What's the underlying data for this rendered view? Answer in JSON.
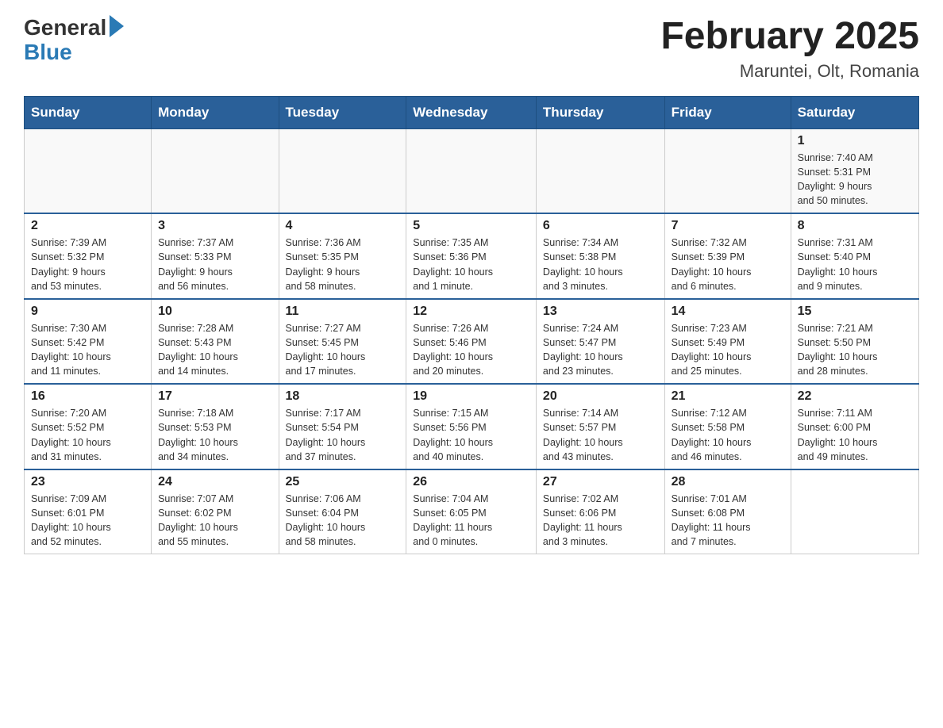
{
  "header": {
    "logo_general": "General",
    "logo_blue": "Blue",
    "month_title": "February 2025",
    "location": "Maruntei, Olt, Romania"
  },
  "days_of_week": [
    "Sunday",
    "Monday",
    "Tuesday",
    "Wednesday",
    "Thursday",
    "Friday",
    "Saturday"
  ],
  "weeks": [
    {
      "days": [
        {
          "num": "",
          "info": ""
        },
        {
          "num": "",
          "info": ""
        },
        {
          "num": "",
          "info": ""
        },
        {
          "num": "",
          "info": ""
        },
        {
          "num": "",
          "info": ""
        },
        {
          "num": "",
          "info": ""
        },
        {
          "num": "1",
          "info": "Sunrise: 7:40 AM\nSunset: 5:31 PM\nDaylight: 9 hours\nand 50 minutes."
        }
      ]
    },
    {
      "days": [
        {
          "num": "2",
          "info": "Sunrise: 7:39 AM\nSunset: 5:32 PM\nDaylight: 9 hours\nand 53 minutes."
        },
        {
          "num": "3",
          "info": "Sunrise: 7:37 AM\nSunset: 5:33 PM\nDaylight: 9 hours\nand 56 minutes."
        },
        {
          "num": "4",
          "info": "Sunrise: 7:36 AM\nSunset: 5:35 PM\nDaylight: 9 hours\nand 58 minutes."
        },
        {
          "num": "5",
          "info": "Sunrise: 7:35 AM\nSunset: 5:36 PM\nDaylight: 10 hours\nand 1 minute."
        },
        {
          "num": "6",
          "info": "Sunrise: 7:34 AM\nSunset: 5:38 PM\nDaylight: 10 hours\nand 3 minutes."
        },
        {
          "num": "7",
          "info": "Sunrise: 7:32 AM\nSunset: 5:39 PM\nDaylight: 10 hours\nand 6 minutes."
        },
        {
          "num": "8",
          "info": "Sunrise: 7:31 AM\nSunset: 5:40 PM\nDaylight: 10 hours\nand 9 minutes."
        }
      ]
    },
    {
      "days": [
        {
          "num": "9",
          "info": "Sunrise: 7:30 AM\nSunset: 5:42 PM\nDaylight: 10 hours\nand 11 minutes."
        },
        {
          "num": "10",
          "info": "Sunrise: 7:28 AM\nSunset: 5:43 PM\nDaylight: 10 hours\nand 14 minutes."
        },
        {
          "num": "11",
          "info": "Sunrise: 7:27 AM\nSunset: 5:45 PM\nDaylight: 10 hours\nand 17 minutes."
        },
        {
          "num": "12",
          "info": "Sunrise: 7:26 AM\nSunset: 5:46 PM\nDaylight: 10 hours\nand 20 minutes."
        },
        {
          "num": "13",
          "info": "Sunrise: 7:24 AM\nSunset: 5:47 PM\nDaylight: 10 hours\nand 23 minutes."
        },
        {
          "num": "14",
          "info": "Sunrise: 7:23 AM\nSunset: 5:49 PM\nDaylight: 10 hours\nand 25 minutes."
        },
        {
          "num": "15",
          "info": "Sunrise: 7:21 AM\nSunset: 5:50 PM\nDaylight: 10 hours\nand 28 minutes."
        }
      ]
    },
    {
      "days": [
        {
          "num": "16",
          "info": "Sunrise: 7:20 AM\nSunset: 5:52 PM\nDaylight: 10 hours\nand 31 minutes."
        },
        {
          "num": "17",
          "info": "Sunrise: 7:18 AM\nSunset: 5:53 PM\nDaylight: 10 hours\nand 34 minutes."
        },
        {
          "num": "18",
          "info": "Sunrise: 7:17 AM\nSunset: 5:54 PM\nDaylight: 10 hours\nand 37 minutes."
        },
        {
          "num": "19",
          "info": "Sunrise: 7:15 AM\nSunset: 5:56 PM\nDaylight: 10 hours\nand 40 minutes."
        },
        {
          "num": "20",
          "info": "Sunrise: 7:14 AM\nSunset: 5:57 PM\nDaylight: 10 hours\nand 43 minutes."
        },
        {
          "num": "21",
          "info": "Sunrise: 7:12 AM\nSunset: 5:58 PM\nDaylight: 10 hours\nand 46 minutes."
        },
        {
          "num": "22",
          "info": "Sunrise: 7:11 AM\nSunset: 6:00 PM\nDaylight: 10 hours\nand 49 minutes."
        }
      ]
    },
    {
      "days": [
        {
          "num": "23",
          "info": "Sunrise: 7:09 AM\nSunset: 6:01 PM\nDaylight: 10 hours\nand 52 minutes."
        },
        {
          "num": "24",
          "info": "Sunrise: 7:07 AM\nSunset: 6:02 PM\nDaylight: 10 hours\nand 55 minutes."
        },
        {
          "num": "25",
          "info": "Sunrise: 7:06 AM\nSunset: 6:04 PM\nDaylight: 10 hours\nand 58 minutes."
        },
        {
          "num": "26",
          "info": "Sunrise: 7:04 AM\nSunset: 6:05 PM\nDaylight: 11 hours\nand 0 minutes."
        },
        {
          "num": "27",
          "info": "Sunrise: 7:02 AM\nSunset: 6:06 PM\nDaylight: 11 hours\nand 3 minutes."
        },
        {
          "num": "28",
          "info": "Sunrise: 7:01 AM\nSunset: 6:08 PM\nDaylight: 11 hours\nand 7 minutes."
        },
        {
          "num": "",
          "info": ""
        }
      ]
    }
  ]
}
